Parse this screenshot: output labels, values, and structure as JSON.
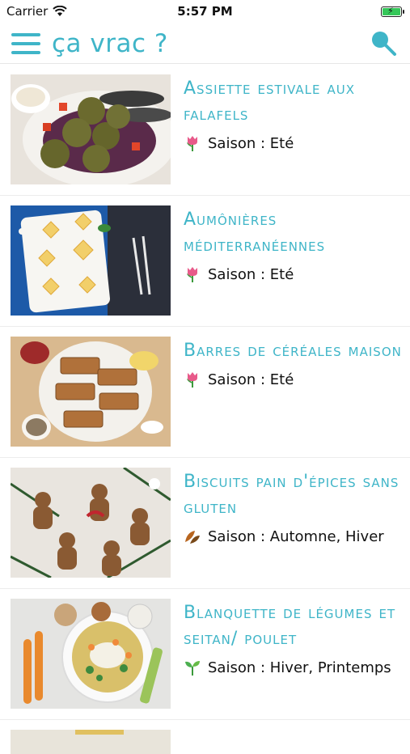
{
  "status": {
    "carrier": "Carrier",
    "time": "5:57 PM"
  },
  "nav": {
    "title": "ça vrac ?"
  },
  "recipes": [
    {
      "title": "Assiette estivale aux falafels",
      "season": "Saison : Eté",
      "season_icon": "tulip-icon"
    },
    {
      "title": "Aumônières méditerranéennes",
      "season": "Saison : Eté",
      "season_icon": "tulip-icon"
    },
    {
      "title": "Barres de céréales maison",
      "season": "Saison : Eté",
      "season_icon": "tulip-icon"
    },
    {
      "title": "Biscuits pain d'épices sans gluten",
      "season": "Saison : Automne, Hiver",
      "season_icon": "autumn-leaves-icon"
    },
    {
      "title": "Blanquette de légumes et seitan/ poulet",
      "season": "Saison : Hiver, Printemps",
      "season_icon": "seedling-icon"
    }
  ],
  "colors": {
    "accent": "#3fb5c8",
    "battery": "#35c759"
  }
}
